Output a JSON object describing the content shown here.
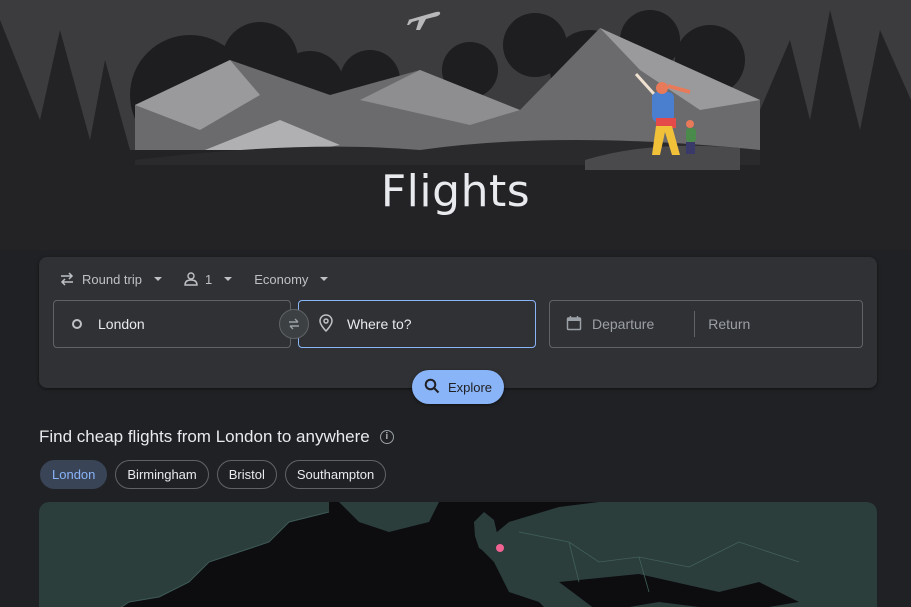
{
  "page": {
    "title": "Flights"
  },
  "search": {
    "trip_type": "Round trip",
    "passengers": "1",
    "cabin_class": "Economy",
    "from_value": "London",
    "to_placeholder": "Where to?",
    "departure_placeholder": "Departure",
    "return_placeholder": "Return",
    "explore_label": "Explore"
  },
  "section": {
    "heading": "Find cheap flights from London to anywhere",
    "chips": [
      {
        "label": "London",
        "selected": true
      },
      {
        "label": "Birmingham",
        "selected": false
      },
      {
        "label": "Bristol",
        "selected": false
      },
      {
        "label": "Southampton",
        "selected": false
      }
    ]
  },
  "icons": {
    "trip_type": "swap-arrows-icon",
    "passengers": "person-icon",
    "origin": "circle-icon",
    "swap": "swap-icon",
    "destination": "location-pin-icon",
    "date": "calendar-icon",
    "explore": "search-icon",
    "info": "info-icon",
    "hero": "airplane-icon"
  },
  "colors": {
    "background": "#202124",
    "card": "#303134",
    "accent": "#8ab4f8",
    "chip_selected_bg": "#394457",
    "map_marker": "#f06292"
  }
}
